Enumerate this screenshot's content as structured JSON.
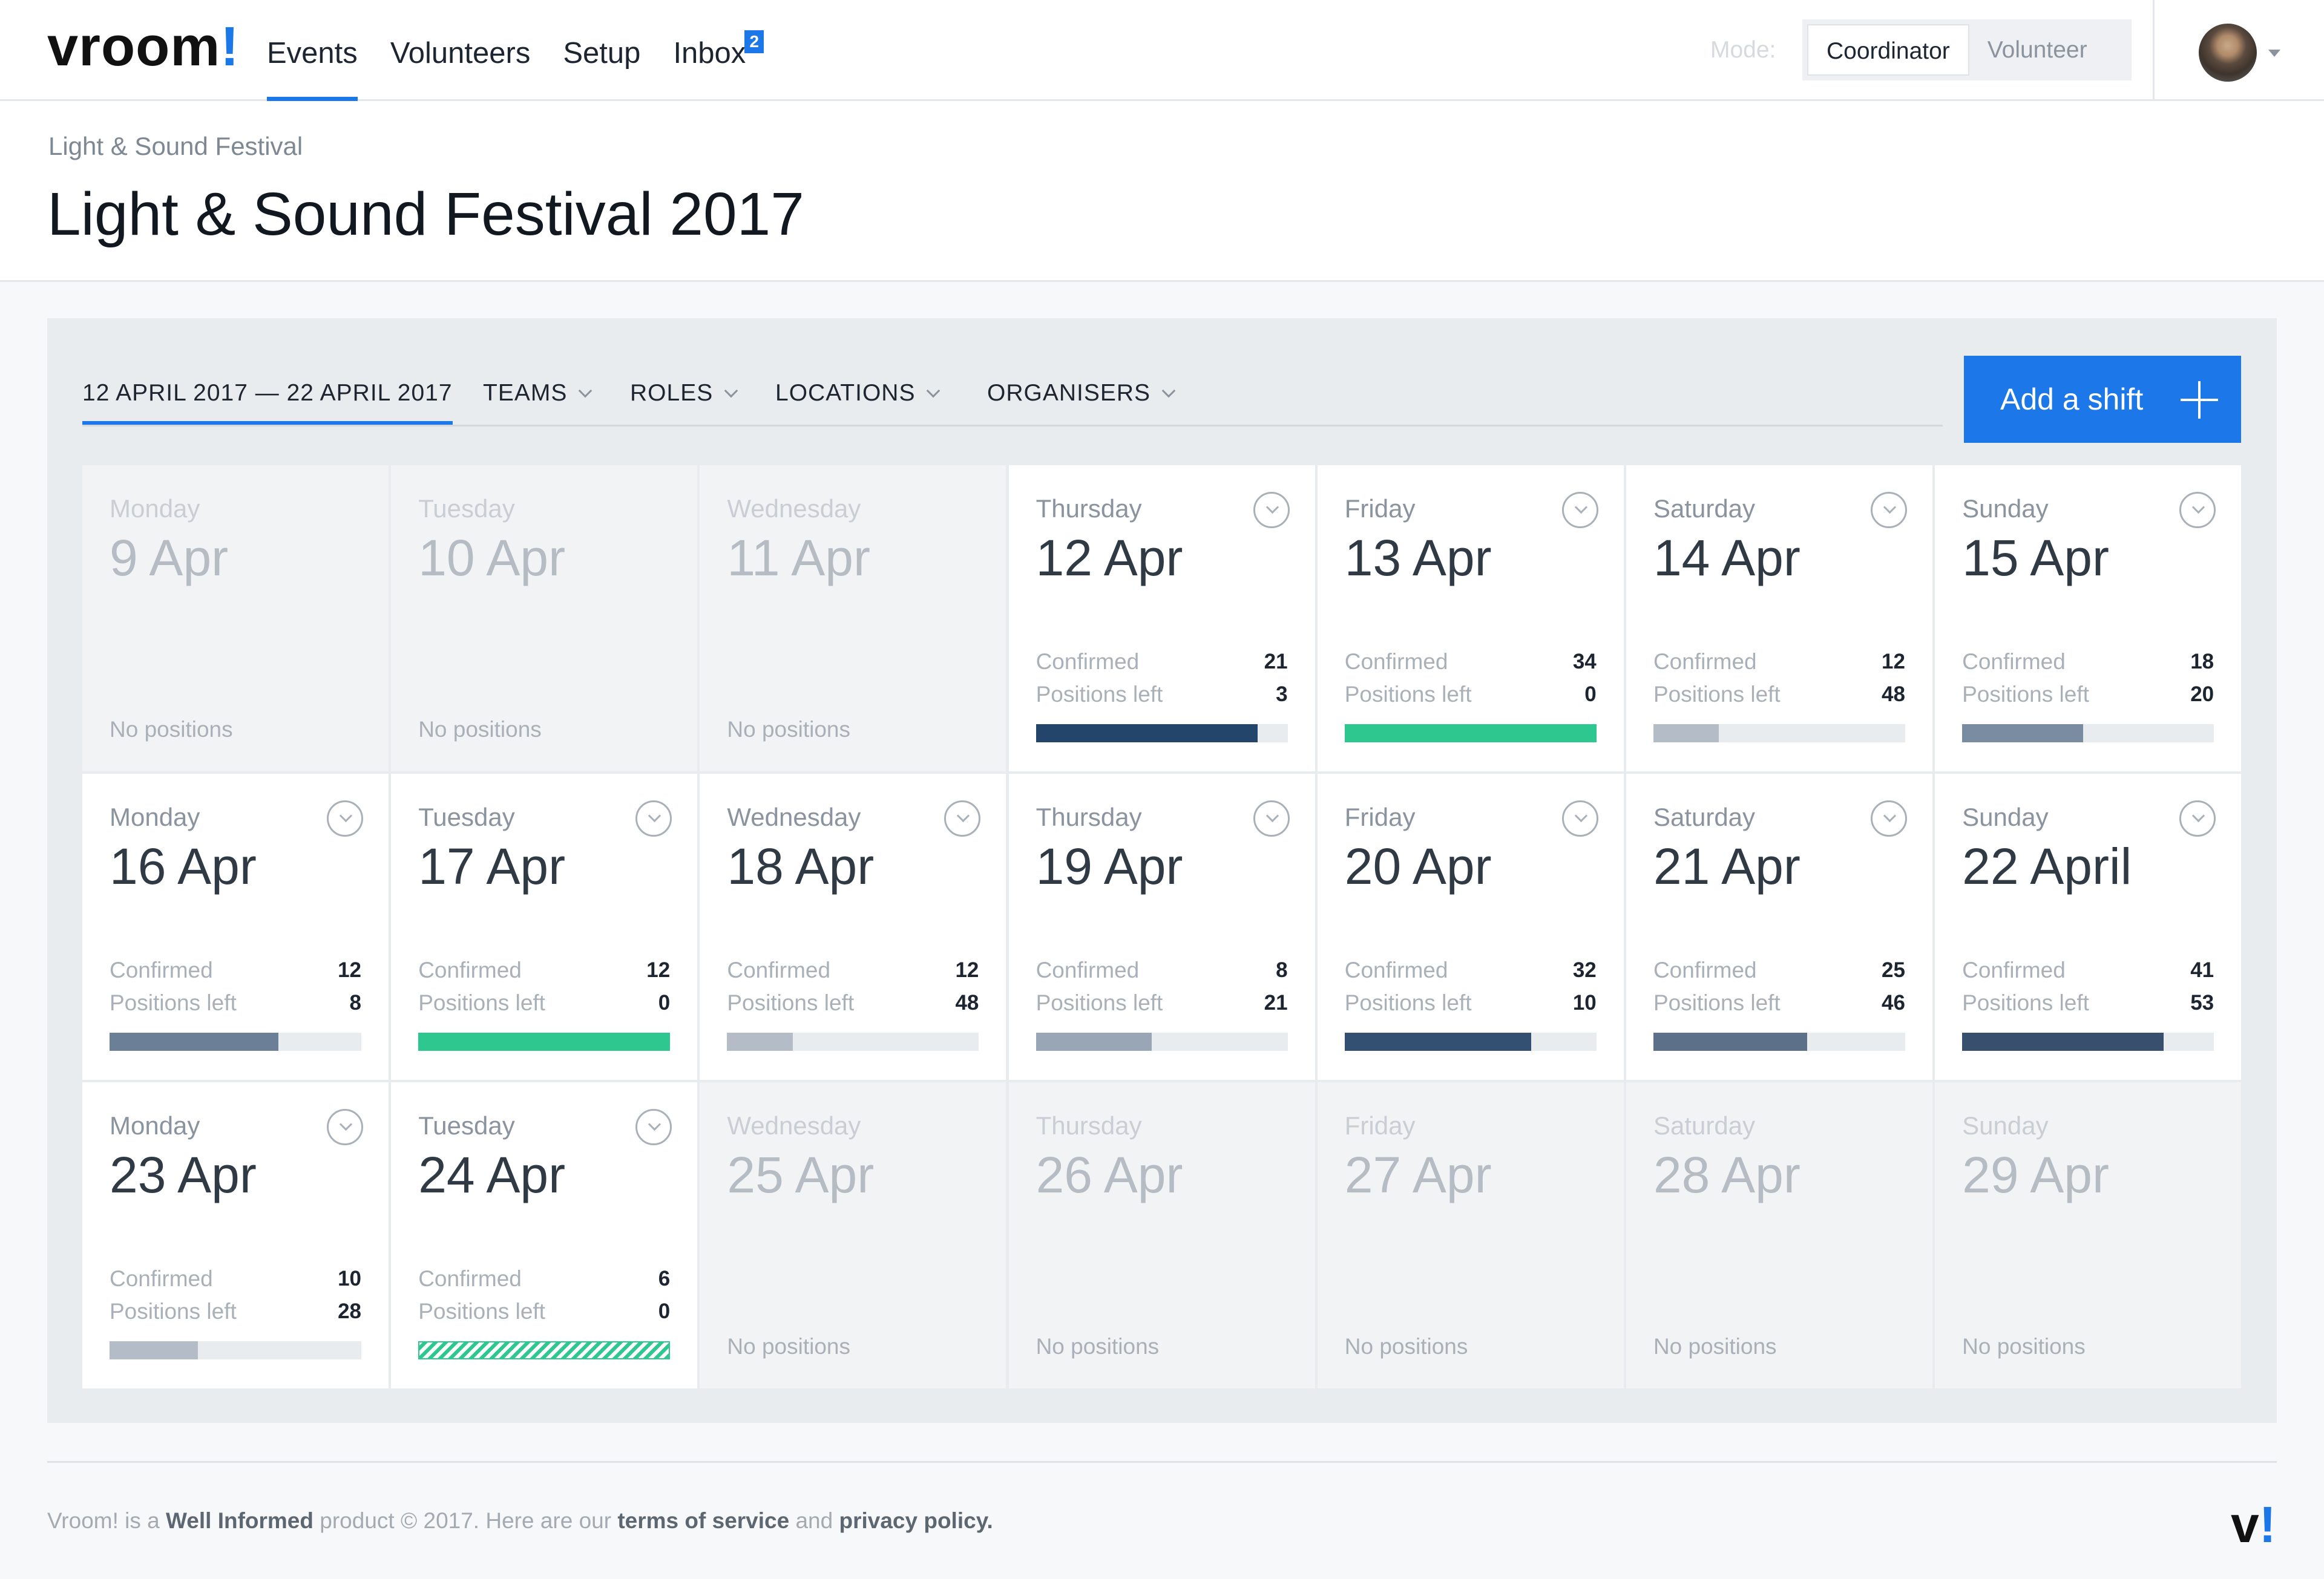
{
  "app": {
    "logo_text": "vroom",
    "logo_mark": "!"
  },
  "nav": {
    "links": [
      {
        "label": "Events",
        "active": true
      },
      {
        "label": "Volunteers"
      },
      {
        "label": "Setup"
      },
      {
        "label": "Inbox",
        "badge": "2"
      }
    ],
    "mode_label": "Mode:",
    "modes": [
      {
        "label": "Coordinator",
        "selected": true
      },
      {
        "label": "Volunteer"
      }
    ]
  },
  "header": {
    "breadcrumb": "Light & Sound Festival",
    "title": "Light & Sound Festival 2017"
  },
  "filters": {
    "date_range": "12 APRIL 2017 — 22 APRIL 2017",
    "teams": "TEAMS",
    "roles": "ROLES",
    "locations": "LOCATIONS",
    "organisers": "ORGANISERS",
    "add_shift": "Add a shift"
  },
  "calendar": {
    "labels": {
      "confirmed": "Confirmed",
      "positions_left": "Positions left",
      "no_positions": "No positions"
    },
    "days": [
      {
        "name": "Monday",
        "date": "9 Apr",
        "active": false
      },
      {
        "name": "Tuesday",
        "date": "10 Apr",
        "active": false
      },
      {
        "name": "Wednesday",
        "date": "11 Apr",
        "active": false
      },
      {
        "name": "Thursday",
        "date": "12 Apr",
        "active": true,
        "confirmed": "21",
        "positions_left": "3",
        "fill": 0.88,
        "color": "#24456b"
      },
      {
        "name": "Friday",
        "date": "13 Apr",
        "active": true,
        "confirmed": "34",
        "positions_left": "0",
        "fill": 1.0,
        "color": "#2ec78f"
      },
      {
        "name": "Saturday",
        "date": "14 Apr",
        "active": true,
        "confirmed": "12",
        "positions_left": "48",
        "fill": 0.26,
        "color": "#b3bcc7"
      },
      {
        "name": "Sunday",
        "date": "15 Apr",
        "active": true,
        "confirmed": "18",
        "positions_left": "20",
        "fill": 0.48,
        "color": "#7a8ca1"
      },
      {
        "name": "Monday",
        "date": "16 Apr",
        "active": true,
        "confirmed": "12",
        "positions_left": "8",
        "fill": 0.67,
        "color": "#6b7f97"
      },
      {
        "name": "Tuesday",
        "date": "17 Apr",
        "active": true,
        "confirmed": "12",
        "positions_left": "0",
        "fill": 1.0,
        "color": "#2ec78f"
      },
      {
        "name": "Wednesday",
        "date": "18 Apr",
        "active": true,
        "confirmed": "12",
        "positions_left": "48",
        "fill": 0.26,
        "color": "#b3bcc7"
      },
      {
        "name": "Thursday",
        "date": "19 Apr",
        "active": true,
        "confirmed": "8",
        "positions_left": "21",
        "fill": 0.46,
        "color": "#98a6b6"
      },
      {
        "name": "Friday",
        "date": "20 Apr",
        "active": true,
        "confirmed": "32",
        "positions_left": "10",
        "fill": 0.74,
        "color": "#334f71"
      },
      {
        "name": "Saturday",
        "date": "21 Apr",
        "active": true,
        "confirmed": "25",
        "positions_left": "46",
        "fill": 0.61,
        "color": "#5d7089"
      },
      {
        "name": "Sunday",
        "date": "22 April",
        "active": true,
        "confirmed": "41",
        "positions_left": "53",
        "fill": 0.8,
        "color": "#38506e"
      },
      {
        "name": "Monday",
        "date": "23 Apr",
        "active": true,
        "confirmed": "10",
        "positions_left": "28",
        "fill": 0.35,
        "color": "#b3bcc7"
      },
      {
        "name": "Tuesday",
        "date": "24 Apr",
        "active": true,
        "confirmed": "6",
        "positions_left": "0",
        "fill": 1.0,
        "color": "#2ec78f",
        "striped": true
      },
      {
        "name": "Wednesday",
        "date": "25 Apr",
        "active": false
      },
      {
        "name": "Thursday",
        "date": "26 Apr",
        "active": false
      },
      {
        "name": "Friday",
        "date": "27 Apr",
        "active": false
      },
      {
        "name": "Saturday",
        "date": "28 Apr",
        "active": false
      },
      {
        "name": "Sunday",
        "date": "29 Apr",
        "active": false
      }
    ]
  },
  "footer": {
    "t1": "Vroom! is a ",
    "company": "Well Informed",
    "t2": " product © 2017. Here are our ",
    "terms": "terms of service",
    "t3": " and ",
    "privacy": "privacy policy",
    "t4": ".",
    "logo_text": "v",
    "logo_mark": "!"
  },
  "colors": {
    "accent": "#1c78e8",
    "success": "#2ec78f"
  }
}
